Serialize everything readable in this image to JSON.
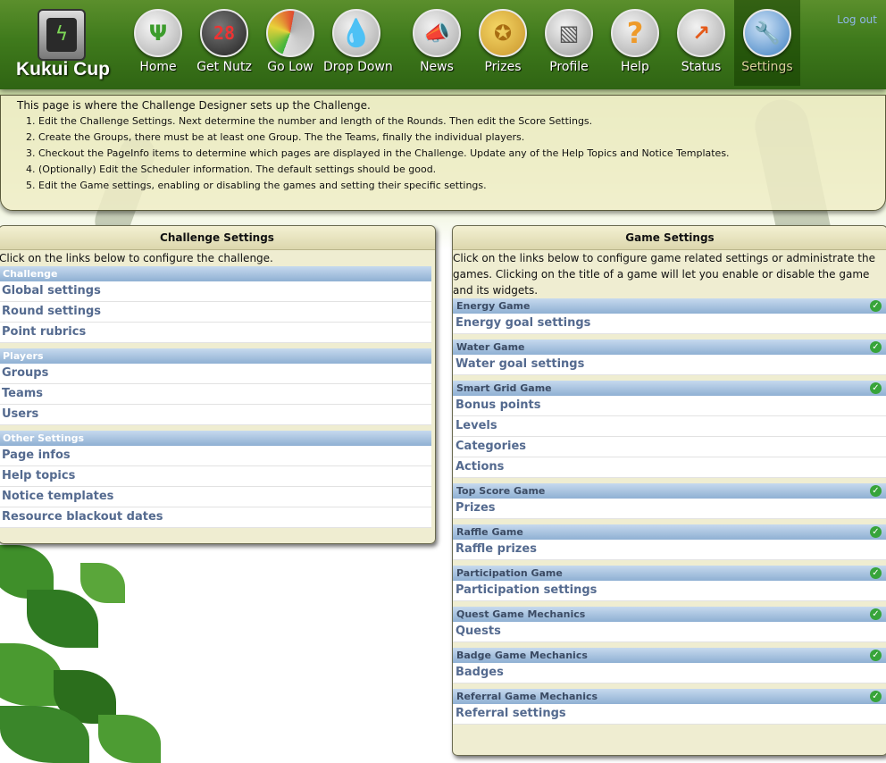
{
  "header": {
    "logo_text": "Kukui Cup",
    "logout": "Log out",
    "nav": [
      {
        "label": "Home",
        "icon": "trophy-icon"
      },
      {
        "label": "Get Nutz",
        "icon": "scoreboard-icon"
      },
      {
        "label": "Go Low",
        "icon": "gauge-icon"
      },
      {
        "label": "Drop Down",
        "icon": "water-drop-icon"
      },
      {
        "label": "News",
        "icon": "megaphone-icon"
      },
      {
        "label": "Prizes",
        "icon": "ribbon-icon"
      },
      {
        "label": "Profile",
        "icon": "profile-icon"
      },
      {
        "label": "Help",
        "icon": "question-icon"
      },
      {
        "label": "Status",
        "icon": "chart-icon"
      },
      {
        "label": "Settings",
        "icon": "wrench-icon"
      }
    ]
  },
  "info": {
    "intro": "This page is where the Challenge Designer sets up the Challenge.",
    "steps": [
      "Edit the Challenge Settings. Next determine the number and length of the Rounds. Then edit the Score Settings.",
      "Create the Groups, there must be at least one Group. The the Teams, finally the individual players.",
      "Checkout the PageInfo items to determine which pages are displayed in the Challenge. Update any of the Help Topics and Notice Templates.",
      "(Optionally) Edit the Scheduler information. The default settings should be good.",
      "Edit the Game settings, enabling or disabling the games and setting their specific settings."
    ]
  },
  "challenge": {
    "title": "Challenge Settings",
    "desc": "Click on the links below to configure the challenge.",
    "sections": [
      {
        "name": "Challenge",
        "items": [
          "Global settings",
          "Round settings",
          "Point rubrics"
        ]
      },
      {
        "name": "Players",
        "items": [
          "Groups",
          "Teams",
          "Users"
        ]
      },
      {
        "name": "Other Settings",
        "items": [
          "Page infos",
          "Help topics",
          "Notice templates",
          "Resource blackout dates"
        ]
      }
    ]
  },
  "games": {
    "title": "Game Settings",
    "desc": "Click on the links below to configure game related settings or administrate the games. Clicking on the title of a game will let you enable or disable the game and its widgets.",
    "sections": [
      {
        "name": "Energy Game",
        "items": [
          "Energy goal settings"
        ]
      },
      {
        "name": "Water Game",
        "items": [
          "Water goal settings"
        ]
      },
      {
        "name": "Smart Grid Game",
        "items": [
          "Bonus points",
          "Levels",
          "Categories",
          "Actions"
        ]
      },
      {
        "name": "Top Score Game",
        "items": [
          "Prizes"
        ]
      },
      {
        "name": "Raffle Game",
        "items": [
          "Raffle prizes"
        ]
      },
      {
        "name": "Participation Game",
        "items": [
          "Participation settings"
        ]
      },
      {
        "name": "Quest Game Mechanics",
        "items": [
          "Quests"
        ]
      },
      {
        "name": "Badge Game Mechanics",
        "items": [
          "Badges"
        ]
      },
      {
        "name": "Referral Game Mechanics",
        "items": [
          "Referral settings"
        ]
      }
    ]
  },
  "colors": {
    "header_green": "#3f7a1c",
    "link_blue": "#546a8f",
    "section_blue": "#8fb0d3",
    "enabled_green": "#37a43a"
  }
}
